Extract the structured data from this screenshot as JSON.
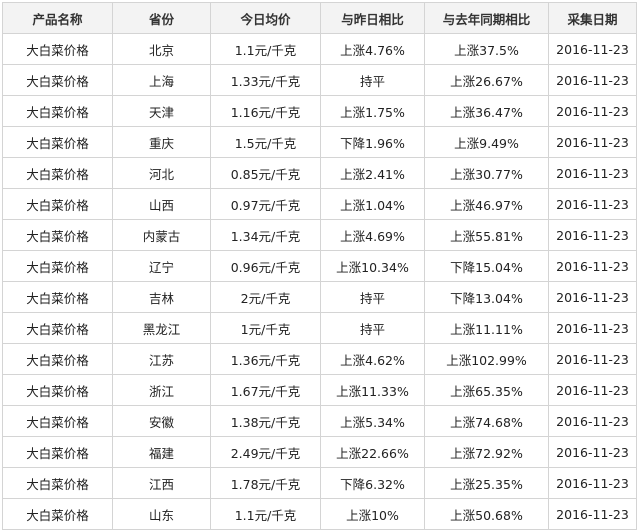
{
  "table": {
    "headers": [
      "产品名称",
      "省份",
      "今日均价",
      "与昨日相比",
      "与去年同期相比",
      "采集日期"
    ],
    "rows": [
      [
        "大白菜价格",
        "北京",
        "1.1元/千克",
        "上涨4.76%",
        "上涨37.5%",
        "2016-11-23"
      ],
      [
        "大白菜价格",
        "上海",
        "1.33元/千克",
        "持平",
        "上涨26.67%",
        "2016-11-23"
      ],
      [
        "大白菜价格",
        "天津",
        "1.16元/千克",
        "上涨1.75%",
        "上涨36.47%",
        "2016-11-23"
      ],
      [
        "大白菜价格",
        "重庆",
        "1.5元/千克",
        "下降1.96%",
        "上涨9.49%",
        "2016-11-23"
      ],
      [
        "大白菜价格",
        "河北",
        "0.85元/千克",
        "上涨2.41%",
        "上涨30.77%",
        "2016-11-23"
      ],
      [
        "大白菜价格",
        "山西",
        "0.97元/千克",
        "上涨1.04%",
        "上涨46.97%",
        "2016-11-23"
      ],
      [
        "大白菜价格",
        "内蒙古",
        "1.34元/千克",
        "上涨4.69%",
        "上涨55.81%",
        "2016-11-23"
      ],
      [
        "大白菜价格",
        "辽宁",
        "0.96元/千克",
        "上涨10.34%",
        "下降15.04%",
        "2016-11-23"
      ],
      [
        "大白菜价格",
        "吉林",
        "2元/千克",
        "持平",
        "下降13.04%",
        "2016-11-23"
      ],
      [
        "大白菜价格",
        "黑龙江",
        "1元/千克",
        "持平",
        "上涨11.11%",
        "2016-11-23"
      ],
      [
        "大白菜价格",
        "江苏",
        "1.36元/千克",
        "上涨4.62%",
        "上涨102.99%",
        "2016-11-23"
      ],
      [
        "大白菜价格",
        "浙江",
        "1.67元/千克",
        "上涨11.33%",
        "上涨65.35%",
        "2016-11-23"
      ],
      [
        "大白菜价格",
        "安徽",
        "1.38元/千克",
        "上涨5.34%",
        "上涨74.68%",
        "2016-11-23"
      ],
      [
        "大白菜价格",
        "福建",
        "2.49元/千克",
        "上涨22.66%",
        "上涨72.92%",
        "2016-11-23"
      ],
      [
        "大白菜价格",
        "江西",
        "1.78元/千克",
        "下降6.32%",
        "上涨25.35%",
        "2016-11-23"
      ],
      [
        "大白菜价格",
        "山东",
        "1.1元/千克",
        "上涨10%",
        "上涨50.68%",
        "2016-11-23"
      ]
    ]
  }
}
